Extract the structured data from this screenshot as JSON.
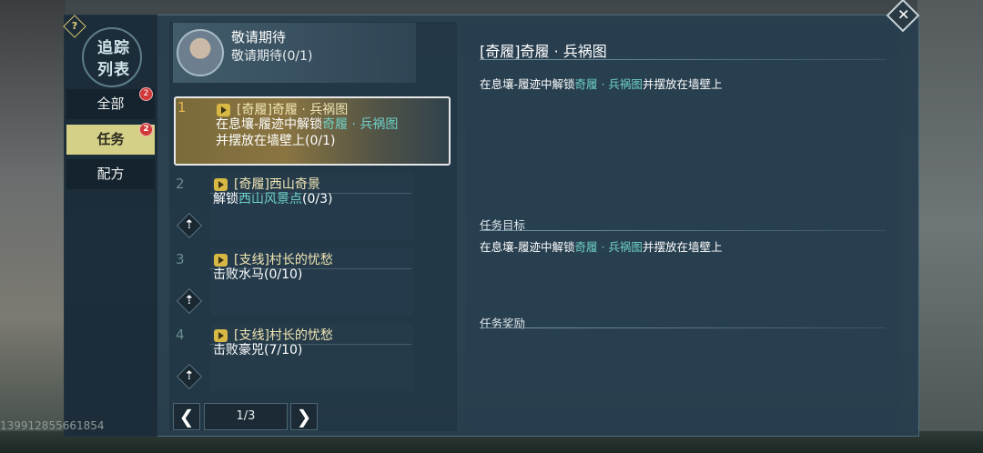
{
  "watermark": "139912855661854",
  "sidebar": {
    "title_line1": "追踪",
    "title_line2": "列表",
    "help": "?",
    "items": [
      {
        "label": "全部",
        "badge": "2"
      },
      {
        "label": "任务",
        "badge": "2"
      },
      {
        "label": "配方"
      }
    ]
  },
  "top_entry": {
    "title": "敬请期待",
    "subtitle": "敬请期待(0/1)"
  },
  "tasks": [
    {
      "num": "1",
      "title": "[奇履]奇履 · 兵祸图",
      "desc_a": "在息壤-履迹中解锁",
      "desc_link": "奇履 · 兵祸图",
      "desc_b": "并摆放在墙壁上(0/1)"
    },
    {
      "num": "2",
      "title": "[奇履]西山奇景",
      "desc_a": "解锁",
      "desc_link": "西山风景点",
      "desc_b": "(0/3)"
    },
    {
      "num": "3",
      "title": "[支线]村长的忧愁",
      "desc": "击败水马(0/10)"
    },
    {
      "num": "4",
      "title": "[支线]村长的忧愁",
      "desc": "击败豪兕(7/10)"
    }
  ],
  "pager": {
    "value": "1/3",
    "prev": "❮",
    "next": "❯"
  },
  "detail": {
    "title": "[奇履]奇履 · 兵祸图",
    "desc_a": "在息壤-履迹中解锁",
    "desc_link": "奇履 · 兵祸图",
    "desc_b": "并摆放在墙壁上",
    "goal_label": "任务目标",
    "goal_a": "在息壤-履迹中解锁",
    "goal_link": "奇履 · 兵祸图",
    "goal_b": "并摆放在墙壁上",
    "reward_label": "任务奖励"
  },
  "close": "✕",
  "colors": {
    "accent_teal": "#6fd2c9",
    "selected_tab": "#d5d087",
    "badge": "#d03a3a"
  }
}
